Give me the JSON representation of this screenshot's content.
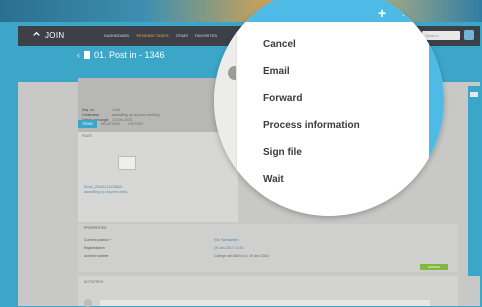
{
  "app": {
    "logo": "JOIN"
  },
  "nav": {
    "items": [
      "DASHBOARD",
      "PENDING TASKS",
      "ITEMS",
      "FAVORITES"
    ],
    "active_index": 1
  },
  "search": {
    "placeholder": "Search"
  },
  "page": {
    "back": "‹",
    "title": "01. Post in - 1346"
  },
  "meta": [
    {
      "label": "Seq. no.",
      "value": "1346"
    },
    {
      "label": "Onderwerp",
      "value": "aanvulling op nog een melding"
    },
    {
      "label": "Datum ontvangst",
      "value": "14-Dec-2016"
    }
  ],
  "tabs": [
    "ITEMS",
    "RELATIONS",
    "HISTORY"
  ],
  "files": {
    "header": "FILES",
    "link_line1": "Email_20161214125840...",
    "link_line2": "aanvulling op nog een meld..."
  },
  "properties": {
    "header": "PROPERTIES",
    "rows": [
      {
        "label": "Current position *",
        "value": "Erik Vanhaeken"
      },
      {
        "label": "Rappeldatum",
        "value": "29-Jan-2017 13:30"
      },
      {
        "label": "Archive number",
        "value": "College van B&W d.d. 19 dec 2016"
      }
    ],
    "button": "HANDLE"
  },
  "activities": {
    "header": "ACTIVITIES",
    "placeholder": "Write a comment..."
  },
  "lens": {
    "plus": "+",
    "dots": "...",
    "menu": [
      "Cancel",
      "Email",
      "Forward",
      "Process information",
      "Sign file",
      "Wait"
    ]
  },
  "colors": {
    "accent": "#3ca6c9",
    "nav_bg": "#3d4147",
    "active_nav": "#f0a84c",
    "green": "#82b83c"
  }
}
